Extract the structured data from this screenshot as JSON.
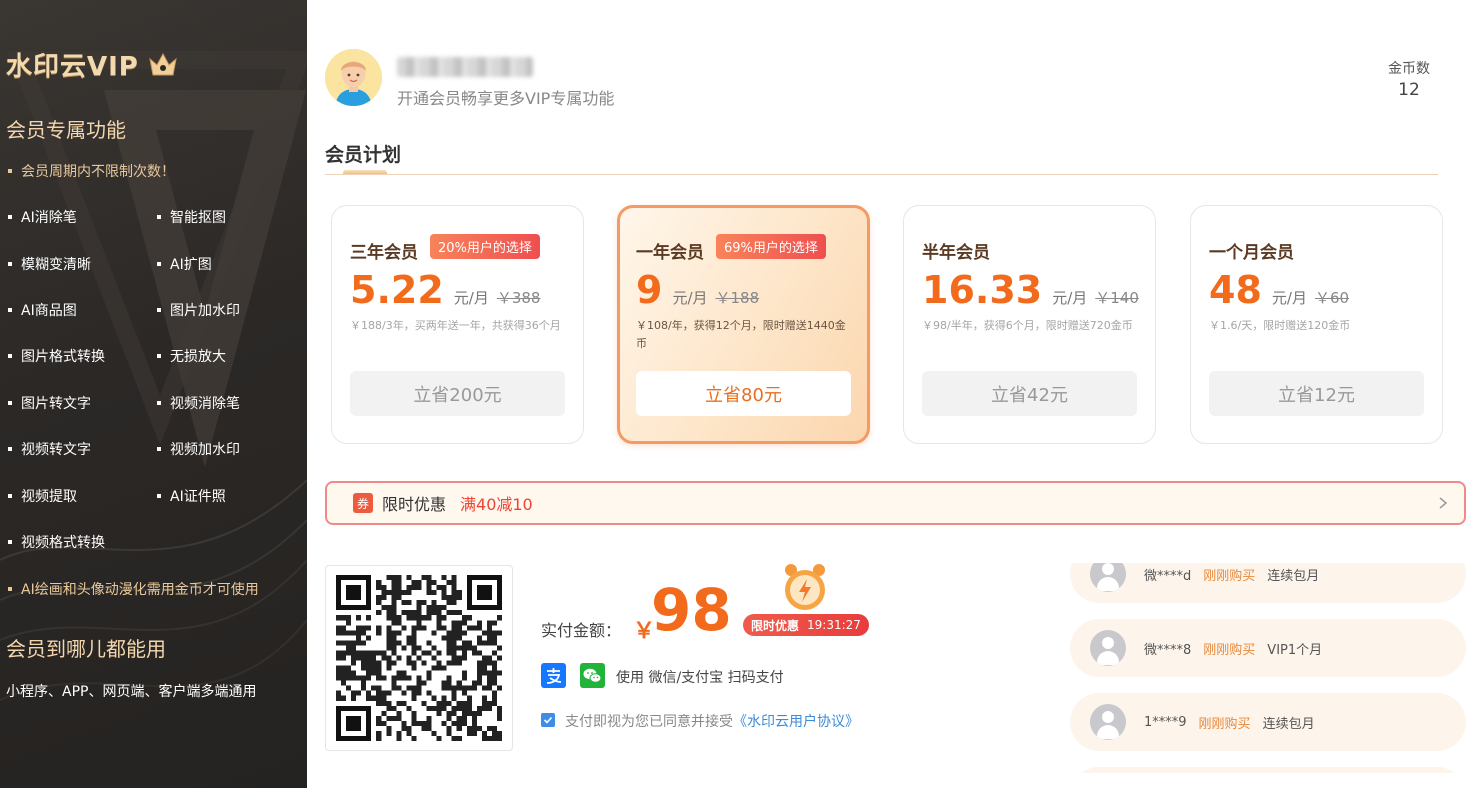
{
  "sidebar": {
    "brand": "水印云VIP",
    "exclusive_title": "会员专属功能",
    "unlimited_note": "会员周期内不限制次数！",
    "features": [
      "AI消除笔",
      "智能抠图",
      "模糊变清晰",
      "AI扩图",
      "AI商品图",
      "图片加水印",
      "图片格式转换",
      "无损放大",
      "图片转文字",
      "视频消除笔",
      "视频转文字",
      "视频加水印",
      "视频提取",
      "AI证件照",
      "视频格式转换"
    ],
    "coins_note": "AI绘画和头像动漫化需用金币才可使用",
    "anywhere_title": "会员到哪儿都能用",
    "anywhere_desc": "小程序、APP、网页端、客户端多端通用"
  },
  "user": {
    "subtitle": "开通会员畅享更多VIP专属功能",
    "coins_label": "金币数",
    "coins_value": "12"
  },
  "plans_section": {
    "title": "会员计划"
  },
  "plans": [
    {
      "name": "三年会员",
      "badge": "20%用户的选择",
      "price": "5.22",
      "unit": "元/月",
      "old_price": "￥388",
      "desc": "￥188/3年，买两年送一年，共获得36个月",
      "save": "立省200元",
      "selected": false
    },
    {
      "name": "一年会员",
      "badge": "69%用户的选择",
      "price": "9",
      "unit": "元/月",
      "old_price": "￥188",
      "desc": "￥108/年，获得12个月，限时赠送1440金币",
      "save": "立省80元",
      "selected": true
    },
    {
      "name": "半年会员",
      "badge": "",
      "price": "16.33",
      "unit": "元/月",
      "old_price": "￥140",
      "desc": "￥98/半年，获得6个月，限时赠送720金币",
      "save": "立省42元",
      "selected": false
    },
    {
      "name": "一个月会员",
      "badge": "",
      "price": "48",
      "unit": "元/月",
      "old_price": "￥60",
      "desc": "￥1.6/天，限时赠送120金币",
      "save": "立省12元",
      "selected": false
    }
  ],
  "promo": {
    "icon_label": "券",
    "label": "限时优惠",
    "value": "满40减10"
  },
  "payment": {
    "amount_label": "实付金额：",
    "currency": "￥",
    "amount": "98",
    "timer_label": "限时优惠",
    "timer_value": "19:31:27",
    "methods_text": "使用 微信/支付宝 扫码支付",
    "agree_text": "支付即视为您已同意并接受",
    "agree_link": "《水印云用户协议》"
  },
  "feed": [
    {
      "user": "微****d",
      "action": "刚刚购买",
      "plan": "连续包月"
    },
    {
      "user": "微****8",
      "action": "刚刚购买",
      "plan": "VIP1个月"
    },
    {
      "user": "1****9",
      "action": "刚刚购买",
      "plan": "连续包月"
    }
  ],
  "colors": {
    "accent": "#f26b1d",
    "sidebar_bg": "#2b2826",
    "gold": "#f3d6ad",
    "promo_red": "#ef4433"
  }
}
